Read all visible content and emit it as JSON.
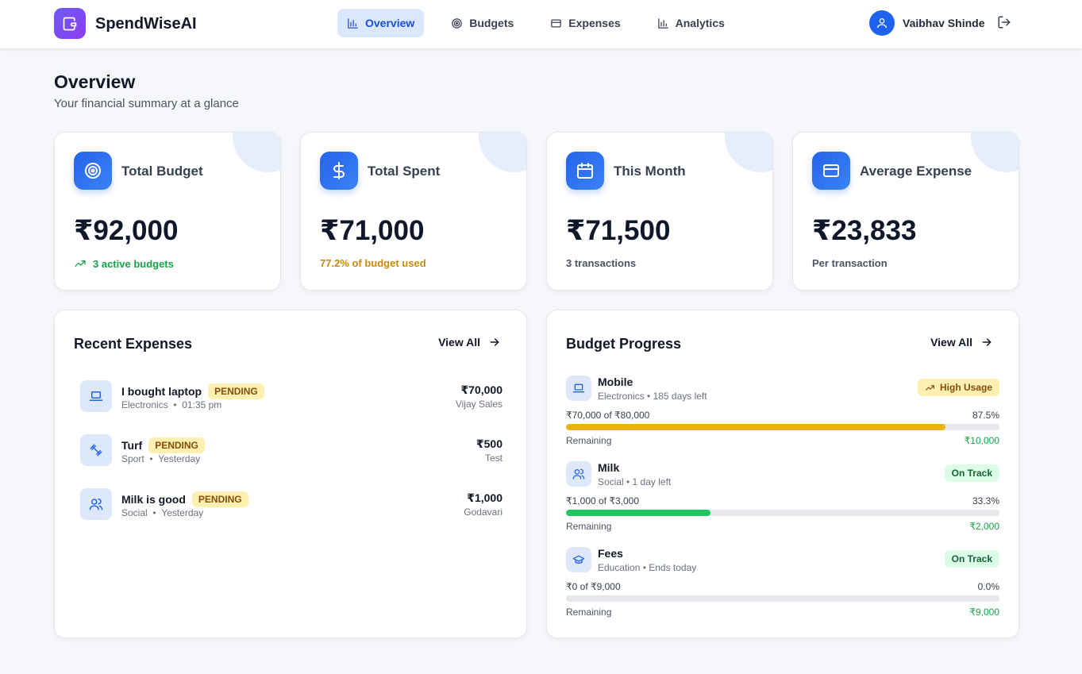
{
  "header": {
    "brand": "SpendWiseAI",
    "nav": [
      {
        "label": "Overview",
        "icon": "bar-chart-icon",
        "active": true
      },
      {
        "label": "Budgets",
        "icon": "target-icon",
        "active": false
      },
      {
        "label": "Expenses",
        "icon": "credit-card-icon",
        "active": false
      },
      {
        "label": "Analytics",
        "icon": "bar-chart-icon",
        "active": false
      }
    ],
    "user_name": "Vaibhav Shinde"
  },
  "page": {
    "title": "Overview",
    "subtitle": "Your financial summary at a glance"
  },
  "stats": [
    {
      "label": "Total Budget",
      "value": "₹92,000",
      "note": "3 active budgets",
      "note_color": "#16a34a",
      "icon": "target-icon"
    },
    {
      "label": "Total Spent",
      "value": "₹71,000",
      "note": "77.2% of budget used",
      "note_color": "#ca8a04",
      "icon": "dollar-icon"
    },
    {
      "label": "This Month",
      "value": "₹71,500",
      "note": "3 transactions",
      "note_color": "#4b5563",
      "icon": "calendar-icon"
    },
    {
      "label": "Average Expense",
      "value": "₹23,833",
      "note": "Per transaction",
      "note_color": "#4b5563",
      "icon": "credit-card-icon"
    }
  ],
  "recent_expenses": {
    "title": "Recent Expenses",
    "view_all": "View All",
    "items": [
      {
        "title": "I bought laptop",
        "status": "PENDING",
        "category": "Electronics",
        "time": "01:35 pm",
        "amount": "₹70,000",
        "vendor": "Vijay Sales",
        "icon": "laptop-icon"
      },
      {
        "title": "Turf",
        "status": "PENDING",
        "category": "Sport",
        "time": "Yesterday",
        "amount": "₹500",
        "vendor": "Test",
        "icon": "dumbbell-icon"
      },
      {
        "title": "Milk is good",
        "status": "PENDING",
        "category": "Social",
        "time": "Yesterday",
        "amount": "₹1,000",
        "vendor": "Godavari",
        "icon": "users-icon"
      }
    ]
  },
  "budget_progress": {
    "title": "Budget Progress",
    "view_all": "View All",
    "remaining_label": "Remaining",
    "items": [
      {
        "name": "Mobile",
        "meta": "Electronics • 185 days left",
        "badge": "High Usage",
        "spent": "₹70,000 of ₹80,000",
        "pct": "87.5%",
        "fraction": 0.875,
        "bar_color": "#eab308",
        "remaining": "₹10,000",
        "icon": "laptop-icon"
      },
      {
        "name": "Milk",
        "meta": "Social • 1 day left",
        "badge": "On Track",
        "spent": "₹1,000 of ₹3,000",
        "pct": "33.3%",
        "fraction": 0.333,
        "bar_color": "#22c55e",
        "remaining": "₹2,000",
        "icon": "users-icon"
      },
      {
        "name": "Fees",
        "meta": "Education • Ends today",
        "badge": "On Track",
        "spent": "₹0 of ₹9,000",
        "pct": "0.0%",
        "fraction": 0.0,
        "bar_color": "#22c55e",
        "remaining": "₹9,000",
        "icon": "graduation-cap-icon"
      }
    ]
  }
}
